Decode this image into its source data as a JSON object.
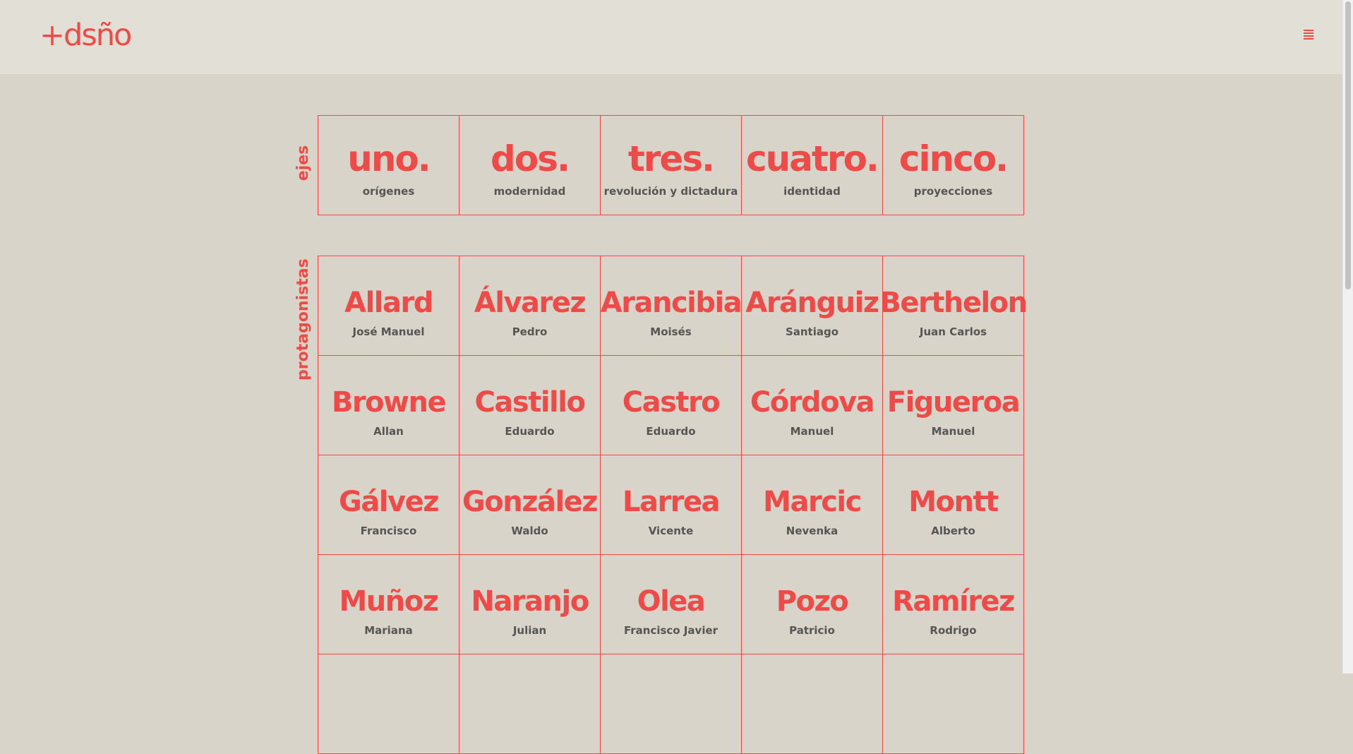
{
  "header": {
    "logo": "+dsño"
  },
  "ejes": {
    "label": "ejes",
    "items": [
      {
        "title": "uno.",
        "subtitle": "orígenes"
      },
      {
        "title": "dos.",
        "subtitle": "modernidad"
      },
      {
        "title": "tres.",
        "subtitle": "revolución y dictadura"
      },
      {
        "title": "cuatro.",
        "subtitle": "identidad"
      },
      {
        "title": "cinco.",
        "subtitle": "proyecciones"
      }
    ]
  },
  "protagonistas": {
    "label": "protagonistas",
    "items": [
      {
        "surname": "Allard",
        "name": "José Manuel"
      },
      {
        "surname": "Álvarez",
        "name": "Pedro"
      },
      {
        "surname": "Arancibia",
        "name": "Moisés"
      },
      {
        "surname": "Aránguiz",
        "name": "Santiago"
      },
      {
        "surname": "Berthelon",
        "name": "Juan Carlos"
      },
      {
        "surname": "Browne",
        "name": "Allan"
      },
      {
        "surname": "Castillo",
        "name": "Eduardo"
      },
      {
        "surname": "Castro",
        "name": "Eduardo"
      },
      {
        "surname": "Córdova",
        "name": "Manuel"
      },
      {
        "surname": "Figueroa",
        "name": "Manuel"
      },
      {
        "surname": "Gálvez",
        "name": "Francisco"
      },
      {
        "surname": "González",
        "name": "Waldo"
      },
      {
        "surname": "Larrea",
        "name": "Vicente"
      },
      {
        "surname": "Marcic",
        "name": "Nevenka"
      },
      {
        "surname": "Montt",
        "name": "Alberto"
      },
      {
        "surname": "Muñoz",
        "name": "Mariana"
      },
      {
        "surname": "Naranjo",
        "name": "Julian"
      },
      {
        "surname": "Olea",
        "name": "Francisco Javier"
      },
      {
        "surname": "Pozo",
        "name": "Patricio"
      },
      {
        "surname": "Ramírez",
        "name": "Rodrigo"
      }
    ]
  },
  "colors": {
    "accent": "#ee4a47",
    "background": "#d8d4c9",
    "header_background": "#e2dfd7",
    "secondary_text": "#555555"
  },
  "icons": {
    "menu": "hamburger-menu-icon"
  }
}
